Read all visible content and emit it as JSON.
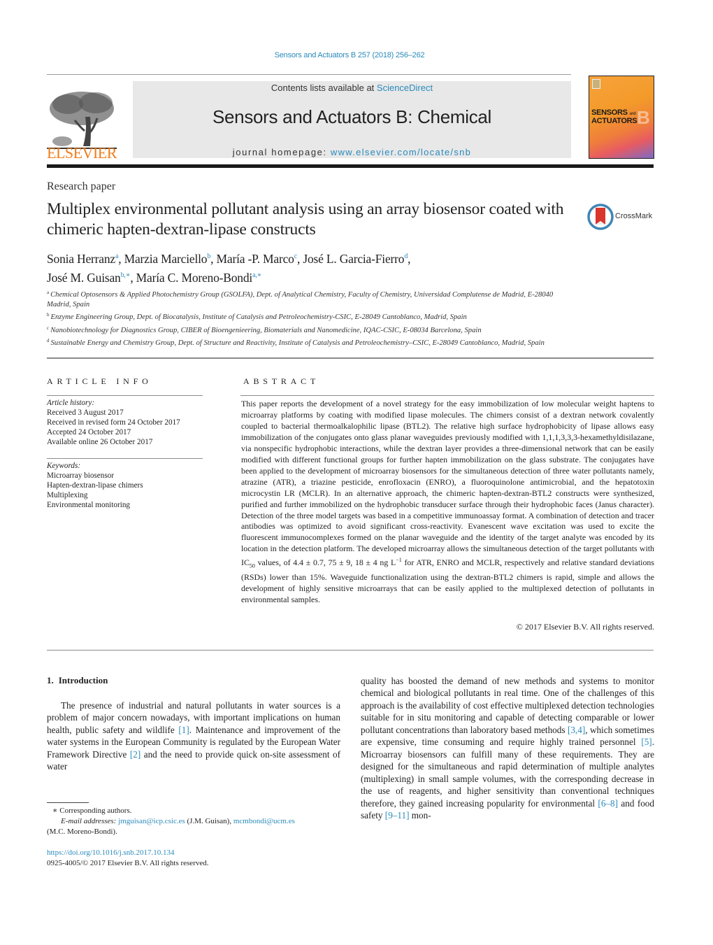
{
  "header": {
    "journal_citation": "Sensors and Actuators B 257 (2018) 256–262",
    "contents_prefix": "Contents lists available at ",
    "contents_link": "ScienceDirect",
    "journal_title": "Sensors and Actuators B: Chemical",
    "homepage_prefix": "journal homepage: ",
    "homepage_link": "www.elsevier.com/locate/snb",
    "publisher_logo_text": "ELSEVIER",
    "cover": {
      "line1": "SENSORS",
      "line1_small": "and",
      "line2": "ACTUATORS",
      "letter": "B"
    },
    "crossmark_label": "CrossMark"
  },
  "article": {
    "type": "Research paper",
    "title": "Multiplex environmental pollutant analysis using an array biosensor coated with chimeric hapten-dextran-lipase constructs",
    "authors": [
      {
        "name": "Sonia Herranz",
        "aff": "a",
        "sep": ", "
      },
      {
        "name": "Marzia Marciello",
        "aff": "b",
        "sep": ", "
      },
      {
        "name": "María -P. Marco",
        "aff": "c",
        "sep": ", "
      },
      {
        "name": "José L. Garcia-Fierro",
        "aff": "d",
        "sep": ","
      },
      {
        "name": "José M. Guisan",
        "aff": "b,∗",
        "sep": ", "
      },
      {
        "name": "María C. Moreno-Bondi",
        "aff": "a,∗",
        "sep": ""
      }
    ],
    "affiliations": [
      {
        "key": "a",
        "text": "Chemical Optosensors & Applied Photochemistry Group (GSOLFA), Dept. of Analytical Chemistry, Faculty of Chemistry, Universidad Complutense de Madrid, E-28040 Madrid, Spain"
      },
      {
        "key": "b",
        "text": "Enzyme Engineering Group, Dept. of Biocatalysis, Institute of Catalysis and Petroleochemistry-CSIC, E-28049 Cantoblanco, Madrid, Spain"
      },
      {
        "key": "c",
        "text": "Nanobiotechnology for Diagnostics Group, CIBER of Bioengenieering, Biomaterials and Nanomedicine, IQAC-CSIC, E-08034 Barcelona, Spain"
      },
      {
        "key": "d",
        "text": "Sustainable Energy and Chemistry Group, Dept. of Structure and Reactivity, Institute of Catalysis and Petroleochemistry–CSIC, E-28049 Cantoblanco, Madrid, Spain"
      }
    ]
  },
  "article_info": {
    "heading": "ARTICLE INFO",
    "history_label": "Article history:",
    "history": [
      "Received 3 August 2017",
      "Received in revised form 24 October 2017",
      "Accepted 24 October 2017",
      "Available online 26 October 2017"
    ],
    "keywords_label": "Keywords:",
    "keywords": [
      "Microarray biosensor",
      "Hapten-dextran-lipase chimers",
      "Multiplexing",
      "Environmental monitoring"
    ]
  },
  "abstract": {
    "heading": "ABSTRACT",
    "part1": "This paper reports the development of a novel strategy for the easy immobilization of low molecular weight haptens to microarray platforms by coating with modified lipase molecules. The chimers consist of a dextran network covalently coupled to bacterial thermoalkalophilic lipase (BTL2). The relative high surface hydrophobicity of lipase allows easy immobilization of the conjugates onto glass planar waveguides previously modified with 1,1,1,3,3,3-hexamethyldisilazane, via nonspecific hydrophobic interactions, while the dextran layer provides a three-dimensional network that can be easily modified with different functional groups for further hapten immobilization on the glass substrate. The conjugates have been applied to the development of microarray biosensors for the simultaneous detection of three water pollutants namely, atrazine (ATR), a triazine pesticide, enrofloxacin (ENRO), a fluoroquinolone antimicrobial, and the hepatotoxin microcystin LR (MCLR). In an alternative approach, the chimeric hapten-dextran-BTL2 constructs were synthesized, purified and further immobilized on the hydrophobic transducer surface through their hydrophobic faces (Janus character). Detection of the three model targets was based in a competitive immunoassay format. A combination of detection and tracer antibodies was optimized to avoid significant cross-reactivity. Evanescent wave excitation was used to excite the fluorescent immunocomplexes formed on the planar waveguide and the identity of the target analyte was encoded by its location in the detection platform. The developed microarray allows the simultaneous detection of the target pollutants with IC",
    "ic_sub": "50",
    "part2": " values, of 4.4 ± 0.7, 75 ± 9, 18 ± 4 ng L",
    "unit_sup": "−1",
    "part3": " for ATR, ENRO and MCLR, respectively and relative standard deviations (RSDs) lower than 15%. Waveguide functionalization using the dextran-BTL2 chimers is rapid, simple and allows the development of highly sensitive microarrays that can be easily applied to the multiplexed detection of pollutants in environmental samples.",
    "copyright": "© 2017 Elsevier B.V. All rights reserved."
  },
  "introduction": {
    "number": "1.",
    "heading": "Introduction",
    "col1": {
      "t1": "The presence of industrial and natural pollutants in water sources is a problem of major concern nowadays, with important implications on human health, public safety and wildlife ",
      "r1": "[1]",
      "t2": ". Maintenance and improvement of the water systems in the European Community is regulated by the European Water Framework Directive ",
      "r2": "[2]",
      "t3": " and the need to provide quick on-site assessment of water"
    },
    "col2": {
      "t1": "quality has boosted the demand of new methods and systems to monitor chemical and biological pollutants in real time. One of the challenges of this approach is the availability of cost effective multiplexed detection technologies suitable for in situ monitoring and capable of detecting comparable or lower pollutant concentrations than laboratory based methods ",
      "r1": "[3,4]",
      "t2": ", which sometimes are expensive, time consuming and require highly trained personnel ",
      "r2": "[5]",
      "t3": ". Microarray biosensors can fulfill many of these requirements. They are designed for the simultaneous and rapid determination of multiple analytes (multiplexing) in small sample volumes, with the corresponding decrease in the use of reagents, and higher sensitivity than conventional techniques therefore, they gained increasing popularity for environmental ",
      "r3": "[6–8]",
      "t4": " and food safety ",
      "r4": "[9–11]",
      "t5": " mon-"
    }
  },
  "footnotes": {
    "corresponding": "∗ Corresponding authors.",
    "email_label": "E-mail addresses: ",
    "email1": "jmguisan@icp.csic.es",
    "email1_owner": " (J.M. Guisan), ",
    "email2": "mcmbondi@ucm.es",
    "email2_owner": "(M.C. Moreno-Bondi).",
    "doi": "https://doi.org/10.1016/j.snb.2017.10.134",
    "issn_copyright": "0925-4005/© 2017 Elsevier B.V. All rights reserved."
  }
}
